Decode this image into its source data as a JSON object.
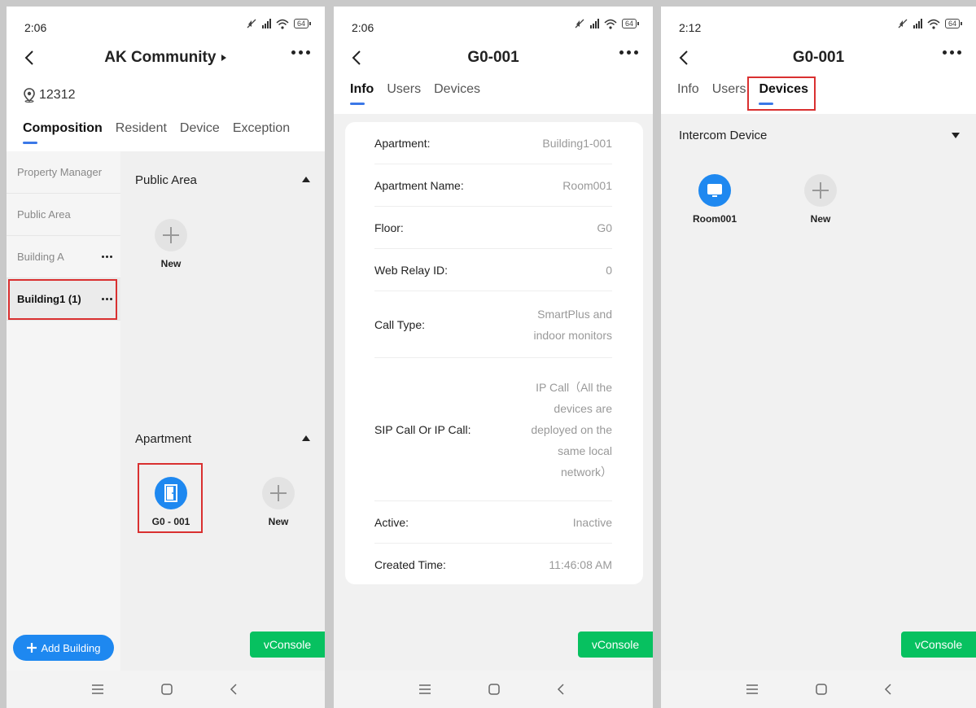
{
  "status": [
    {
      "time": "2:06",
      "battery": "64"
    },
    {
      "time": "2:06",
      "battery": "64"
    },
    {
      "time": "2:12",
      "battery": "64"
    }
  ],
  "screen1": {
    "title": "AK Community",
    "location": "12312",
    "tabs": [
      "Composition",
      "Resident",
      "Device",
      "Exception"
    ],
    "sidebar": [
      {
        "label": "Property Manager"
      },
      {
        "label": "Public Area"
      },
      {
        "label": "Building A"
      },
      {
        "label": "Building1 (1)"
      }
    ],
    "public_area": {
      "heading": "Public Area",
      "new_label": "New"
    },
    "apartment": {
      "heading": "Apartment",
      "unit_label": "G0 - 001",
      "new_label": "New"
    },
    "add_building": "Add Building",
    "vconsole": "vConsole"
  },
  "screen2": {
    "title": "G0-001",
    "tabs": [
      "Info",
      "Users",
      "Devices"
    ],
    "rows": [
      {
        "label": "Apartment:",
        "value": "Building1-001"
      },
      {
        "label": "Apartment Name:",
        "value": "Room001"
      },
      {
        "label": "Floor:",
        "value": "G0"
      },
      {
        "label": "Web Relay ID:",
        "value": "0"
      },
      {
        "label": "Call Type:",
        "value": "SmartPlus and indoor monitors"
      },
      {
        "label": "SIP Call Or IP Call:",
        "value": "IP Call（All the devices are deployed on the same local network）"
      },
      {
        "label": "Active:",
        "value": "Inactive"
      },
      {
        "label": "Created Time:",
        "value": "11:46:08 AM"
      }
    ],
    "vconsole": "vConsole"
  },
  "screen3": {
    "title": "G0-001",
    "tabs": [
      "Info",
      "Users",
      "Devices"
    ],
    "section": "Intercom Device",
    "device_label": "Room001",
    "new_label": "New",
    "vconsole": "vConsole"
  },
  "colors": {
    "accent": "#1e88f0",
    "tab_indicator": "#3b78e7",
    "vconsole": "#07c160",
    "highlight": "#d93030"
  }
}
